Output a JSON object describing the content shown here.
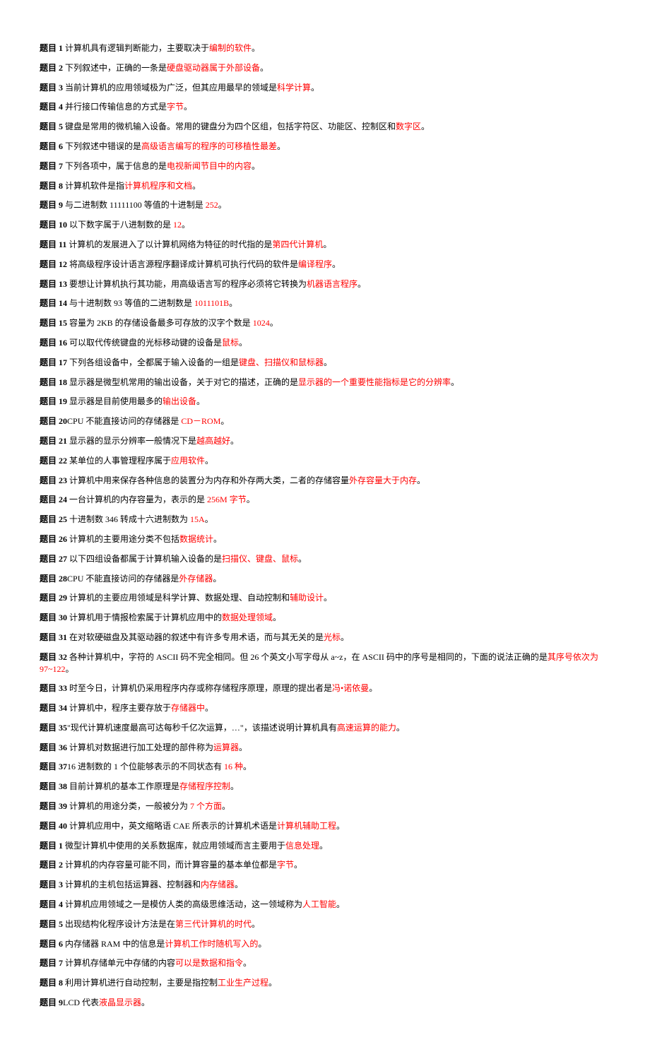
{
  "questions": [
    {
      "label": "题目 1",
      "before": " 计算机具有逻辑判断能力，主要取决于",
      "answer": "编制的软件",
      "after": "。"
    },
    {
      "label": "题目 2",
      "before": " 下列叙述中，正确的一条是",
      "answer": "硬盘驱动器属于外部设备",
      "after": "。"
    },
    {
      "label": "题目 3",
      "before": " 当前计算机的应用领域极为广泛，但其应用最早的领域是",
      "answer": "科学计算",
      "after": "。"
    },
    {
      "label": "题目 4",
      "before": " 并行接口传输信息的方式是",
      "answer": "字节",
      "after": "。"
    },
    {
      "label": "题目 5",
      "before": " 键盘是常用的微机输入设备。常用的键盘分为四个区组，包括字符区、功能区、控制区和",
      "answer": "数字区",
      "after": "。"
    },
    {
      "label": "题目 6",
      "before": " 下列叙述中错误的是",
      "answer": "高级语言编写的程序的可移植性最差",
      "after": "。"
    },
    {
      "label": "题目 7",
      "before": " 下列各项中，属于信息的是",
      "answer": "电视新闻节目中的内容",
      "after": "。"
    },
    {
      "label": "题目 8",
      "before": " 计算机软件是指",
      "answer": "计算机程序和文档",
      "after": "。"
    },
    {
      "label": "题目 9",
      "before": " 与二进制数 11111100 等值的十进制是 ",
      "answer": "252",
      "after": "。"
    },
    {
      "label": "题目 10",
      "before": " 以下数字属于八进制数的是 ",
      "answer": "12",
      "after": "。"
    },
    {
      "label": "题目 11",
      "before": " 计算机的发展进入了以计算机网络为特征的时代指的是",
      "answer": "第四代计算机",
      "after": "。"
    },
    {
      "label": "题目 12",
      "before": " 将高级程序设计语言源程序翻译成计算机可执行代码的软件是",
      "answer": "编译程序",
      "after": "。"
    },
    {
      "label": "题目 13",
      "before": " 要想让计算机执行其功能，用高级语言写的程序必须将它转换为",
      "answer": "机器语言程序",
      "after": "。"
    },
    {
      "label": "题目 14",
      "before": " 与十进制数 93 等值的二进制数是 ",
      "answer": "1011101B",
      "after": "。"
    },
    {
      "label": "题目 15",
      "before": " 容量为 2KB 的存储设备最多可存放的汉字个数是 ",
      "answer": "1024",
      "after": "。"
    },
    {
      "label": "题目 16",
      "before": " 可以取代传统键盘的光标移动键的设备是",
      "answer": "鼠标",
      "after": "。"
    },
    {
      "label": "题目 17",
      "before": " 下列各组设备中，全都属于输入设备的一组是",
      "answer": "键盘、扫描仪和鼠标器",
      "after": "。"
    },
    {
      "label": "题目 18",
      "before": " 显示器是微型机常用的输出设备，关于对它的描述，正确的是",
      "answer": "显示器的一个重要性能指标是它的分辨率",
      "after": "。"
    },
    {
      "label": "题目 19",
      "before": " 显示器是目前使用最多的",
      "answer": "输出设备",
      "after": "。"
    },
    {
      "label": "题目 20",
      "before": "CPU 不能直接访问的存储器是 ",
      "answer": "CD－ROM",
      "after": "。"
    },
    {
      "label": "题目 21",
      "before": " 显示器的显示分辨率一般情况下是",
      "answer": "越高越好",
      "after": "。"
    },
    {
      "label": "题目 22",
      "before": " 某单位的人事管理程序属于",
      "answer": "应用软件",
      "after": "。"
    },
    {
      "label": "题目 23",
      "before": " 计算机中用来保存各种信息的装置分为内存和外存两大类，二者的存储容量",
      "answer": "外存容量大于内存",
      "after": "。"
    },
    {
      "label": "题目 24",
      "before": " 一台计算机的内存容量为，表示的是 ",
      "answer": "256M 字节",
      "after": "。"
    },
    {
      "label": "题目 25",
      "before": " 十进制数 346 转成十六进制数为 ",
      "answer": "15A",
      "after": "。"
    },
    {
      "label": "题目 26",
      "before": " 计算机的主要用途分类不包括",
      "answer": "数据统计",
      "after": "。"
    },
    {
      "label": "题目 27",
      "before": " 以下四组设备都属于计算机输入设备的是",
      "answer": "扫描仪、键盘、鼠标",
      "after": "。"
    },
    {
      "label": "题目 28",
      "before": "CPU 不能直接访问的存储器是",
      "answer": "外存储器",
      "after": "。"
    },
    {
      "label": "题目 29",
      "before": " 计算机的主要应用领域是科学计算、数据处理、自动控制和",
      "answer": "辅助设计",
      "after": "。"
    },
    {
      "label": "题目 30",
      "before": " 计算机用于情报检索属于计算机应用中的",
      "answer": "数据处理领域",
      "after": "。"
    },
    {
      "label": "题目 31",
      "before": " 在对软硬磁盘及其驱动器的叙述中有许多专用术语，而与其无关的是",
      "answer": "光标",
      "after": "。"
    },
    {
      "label": "题目 32",
      "before": " 各种计算机中，字符的 ASCII 码不完全相同。但 26 个英文小写字母从 a~z，在 ASCII 码中的序号是相同的，下面的说法正确的是",
      "answer": "其序号依次为 97~122",
      "after": "。"
    },
    {
      "label": "题目 33",
      "before": " 时至今日，计算机仍采用程序内存或称存储程序原理，原理的提出者是",
      "answer": "冯•诺依曼",
      "after": "。"
    },
    {
      "label": "题目 34",
      "before": " 计算机中，程序主要存放于",
      "answer": "存储器中",
      "after": "。"
    },
    {
      "label": "题目 35",
      "before": "\"现代计算机速度最高可达每秒千亿次运算，…\"，该描述说明计算机具有",
      "answer": "高速运算的能力",
      "after": "。"
    },
    {
      "label": "题目 36",
      "before": " 计算机对数据进行加工处理的部件称为",
      "answer": "运算器",
      "after": "。"
    },
    {
      "label": "题目 37",
      "before": "16 进制数的 1 个位能够表示的不同状态有 ",
      "answer": "16 种",
      "after": "。"
    },
    {
      "label": "题目 38",
      "before": " 目前计算机的基本工作原理是",
      "answer": "存储程序控制",
      "after": "。"
    },
    {
      "label": "题目 39",
      "before": " 计算机的用途分类，一般被分为 ",
      "answer": "7 个方面",
      "after": "。"
    },
    {
      "label": "题目 40",
      "before": " 计算机应用中，英文缩略语 CAE 所表示的计算机术语是",
      "answer": "计算机辅助工程",
      "after": "。"
    },
    {
      "label": "题目 1",
      "before": " 微型计算机中使用的关系数据库，就应用领域而言主要用于",
      "answer": "信息处理",
      "after": "。"
    },
    {
      "label": "题目 2",
      "before": " 计算机的内存容量可能不同，而计算容量的基本单位都是",
      "answer": "字节",
      "after": "。"
    },
    {
      "label": "题目 3",
      "before": " 计算机的主机包括运算器、控制器和",
      "answer": "内存储器",
      "after": "。"
    },
    {
      "label": "题目 4",
      "before": " 计算机应用领域之一是模仿人类的高级思维活动，这一领域称为",
      "answer": "人工智能",
      "after": "。"
    },
    {
      "label": "题目 5",
      "before": " 出现结构化程序设计方法是在",
      "answer": "第三代计算机的时代",
      "after": "。"
    },
    {
      "label": "题目 6",
      "before": " 内存储器 RAM 中的信息是",
      "answer": "计算机工作时随机写入的",
      "after": "。"
    },
    {
      "label": "题目 7",
      "before": " 计算机存储单元中存储的内容",
      "answer": "可以是数据和指令",
      "after": "。"
    },
    {
      "label": "题目 8",
      "before": " 利用计算机进行自动控制，主要是指控制",
      "answer": "工业生产过程",
      "after": "。"
    },
    {
      "label": "题目 9",
      "before": "LCD 代表",
      "answer": "液晶显示器",
      "after": "。"
    }
  ]
}
